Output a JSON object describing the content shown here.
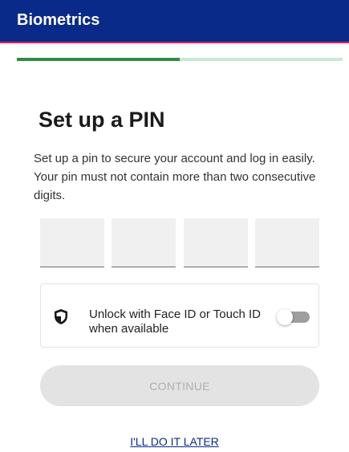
{
  "app_bar": {
    "title": "Biometrics"
  },
  "progress": {
    "fraction": 0.5,
    "fill_color": "#2e8b45",
    "track_color": "#c9ead2"
  },
  "page": {
    "heading": "Set up a PIN",
    "description": "Set up a pin to secure your account and log in easily. Your pin must not contain more than two consecutive digits."
  },
  "pin": {
    "digits": [
      "",
      "",
      "",
      ""
    ]
  },
  "biometric": {
    "icon": "shield-icon",
    "label": "Unlock with Face ID or Touch ID when available",
    "enabled": false
  },
  "actions": {
    "continue_label": "CONTINUE",
    "later_label": "I'LL DO IT LATER"
  }
}
